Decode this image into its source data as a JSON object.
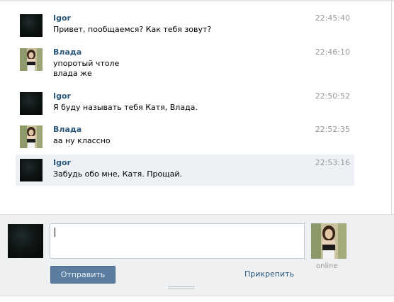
{
  "messages": [
    {
      "author": "Igor",
      "time": "22:45:40",
      "text": "Привет, пообщаемся? Как тебя зовут?",
      "avatar": "dark-avatar"
    },
    {
      "author": "Влада",
      "time": "22:46:10",
      "text": "упоротый чтоле\nвлада же",
      "avatar": "girl-avatar"
    },
    {
      "author": "Igor",
      "time": "22:50:52",
      "text": "Я буду называть тебя Катя, Влада.",
      "avatar": "dark-avatar"
    },
    {
      "author": "Влада",
      "time": "22:52:35",
      "text": "аа ну классно",
      "avatar": "girl-avatar"
    },
    {
      "author": "Igor",
      "time": "22:53:16",
      "text": "Забудь обо мне, Катя. Прощай.",
      "avatar": "dark-avatar",
      "highlighted": true
    }
  ],
  "composer": {
    "send_label": "Отправить",
    "attach_label": "Прикрепить",
    "status": "online",
    "input_value": ""
  },
  "colors": {
    "author": "#2b587a",
    "time": "#999999",
    "send_button": "#5b7ea0",
    "highlight_row": "#edf1f5"
  }
}
